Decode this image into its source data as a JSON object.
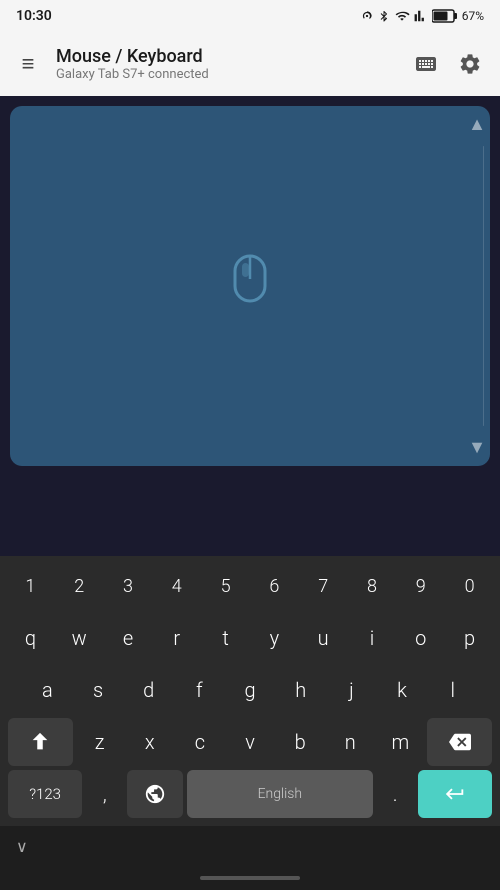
{
  "statusBar": {
    "time": "10:30",
    "battery": "67%",
    "batteryLevel": 67
  },
  "appBar": {
    "title": "Mouse / Keyboard",
    "subtitle": "Galaxy Tab S7+ connected",
    "menuIcon": "≡",
    "keyboardIcon": "⌨",
    "settingsIcon": "⚙"
  },
  "touchpad": {
    "arrowUp": "▲",
    "arrowDown": "▼"
  },
  "keyboard": {
    "rows": {
      "numbers": [
        "1",
        "2",
        "3",
        "4",
        "5",
        "6",
        "7",
        "8",
        "9",
        "0"
      ],
      "row1": [
        "q",
        "w",
        "e",
        "r",
        "t",
        "y",
        "u",
        "i",
        "o",
        "p"
      ],
      "row2": [
        "a",
        "s",
        "d",
        "f",
        "g",
        "h",
        "j",
        "k",
        "l"
      ],
      "row3": [
        "z",
        "x",
        "c",
        "v",
        "b",
        "n",
        "m"
      ]
    },
    "shiftIcon": "⇧",
    "backspaceIcon": "⌫",
    "symbolsLabel": "?123",
    "commaLabel": ",",
    "globeIcon": "⊕",
    "spaceLabel": "English",
    "periodLabel": ".",
    "enterIcon": "↵",
    "chevronDown": "∨"
  }
}
